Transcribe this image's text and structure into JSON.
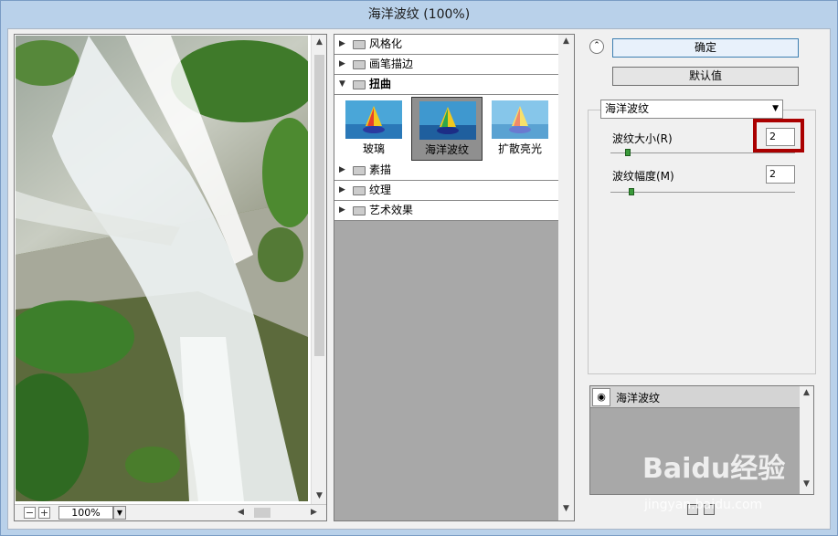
{
  "window": {
    "title": "海洋波纹 (100%)"
  },
  "preview": {
    "zoom_out": "−",
    "zoom_in": "+",
    "zoom_value": "100%"
  },
  "filter_gallery": {
    "categories_top": [
      {
        "label": "风格化"
      },
      {
        "label": "画笔描边"
      }
    ],
    "open_category": {
      "label": "扭曲"
    },
    "filters": [
      {
        "label": "玻璃"
      },
      {
        "label": "海洋波纹",
        "selected": true
      },
      {
        "label": "扩散亮光"
      }
    ],
    "categories_bottom": [
      {
        "label": "素描"
      },
      {
        "label": "纹理"
      },
      {
        "label": "艺术效果"
      }
    ]
  },
  "actions": {
    "ok_label": "确定",
    "default_label": "默认值"
  },
  "settings": {
    "filter_select": "海洋波纹",
    "ripple_size_label": "波纹大小(R)",
    "ripple_size_value": "2",
    "ripple_magnitude_label": "波纹幅度(M)",
    "ripple_magnitude_value": "2",
    "ripple_size_level": 0.08,
    "ripple_magnitude_level": 0.1
  },
  "layers": {
    "items": [
      {
        "label": "海洋波纹"
      }
    ]
  },
  "watermark": {
    "text": "Baidu经验",
    "sub": "jingyan.baidu.com"
  },
  "colors": {
    "highlight": "#aa0000",
    "accent": "#3c7fb1"
  }
}
